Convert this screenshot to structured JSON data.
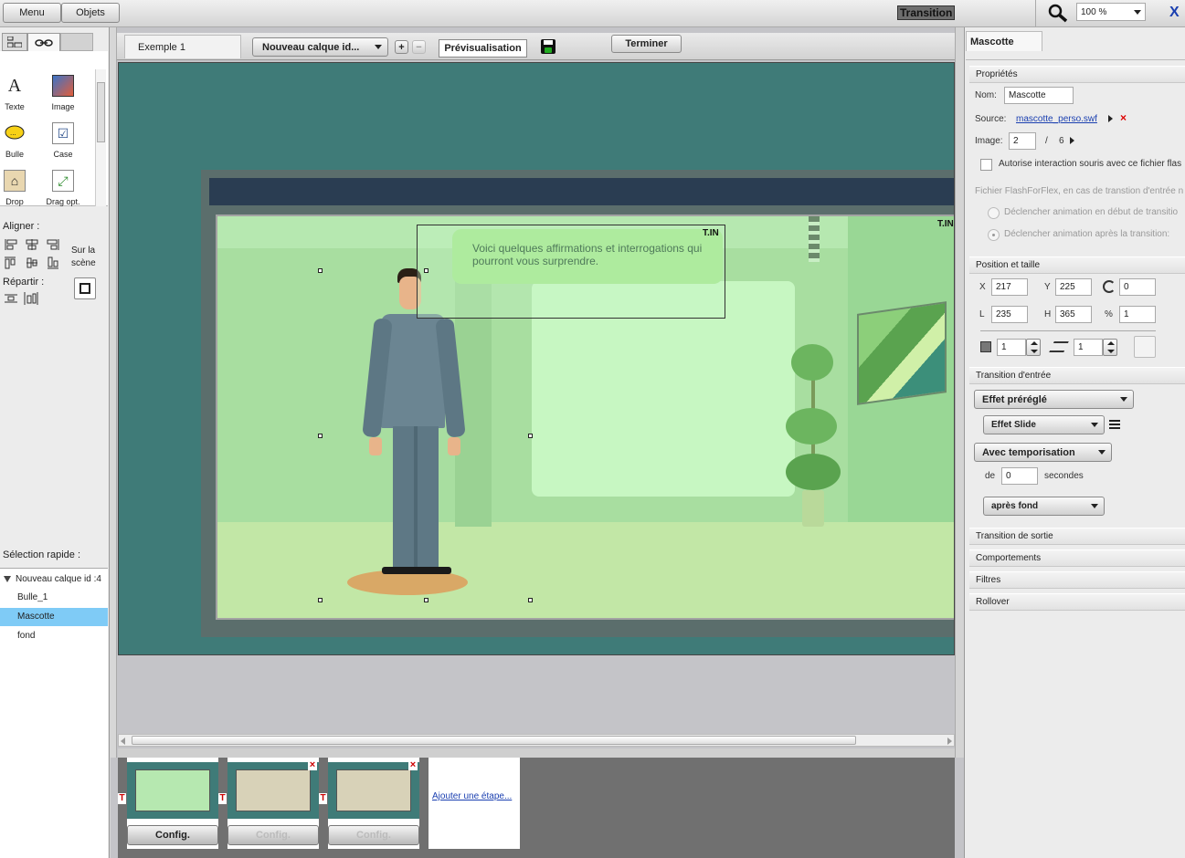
{
  "topbar": {
    "menu": "Menu",
    "objets": "Objets",
    "mode": "Transition",
    "zoom": "100 %",
    "close": "X"
  },
  "tools": [
    {
      "label": "Texte",
      "icon": "text-tool-icon",
      "glyph": "A"
    },
    {
      "label": "Image",
      "icon": "image-tool-icon",
      "glyph": "▣"
    },
    {
      "label": "Bulle",
      "icon": "speech-bubble-icon",
      "glyph": "💬"
    },
    {
      "label": "Case",
      "icon": "checkbox-tool-icon",
      "glyph": "☑"
    },
    {
      "label": "Drop",
      "icon": "drop-tool-icon",
      "glyph": "⌂"
    },
    {
      "label": "Drag opt.",
      "icon": "drag-option-icon",
      "glyph": "⤢"
    }
  ],
  "align": {
    "title": "Aligner :",
    "scene": "Sur la scène",
    "repartir": "Répartir :"
  },
  "quick": {
    "title": "Sélection rapide :",
    "root": "Nouveau calque id :4",
    "items": [
      "Bulle_1",
      "Mascotte",
      "fond"
    ]
  },
  "editor": {
    "tab": "Exemple 1",
    "layer": "Nouveau calque id...",
    "preview": "Prévisualisation",
    "finish": "Terminer",
    "plus": "+",
    "minus": "−"
  },
  "stage": {
    "bubble_text": "Voici quelques affirmations et interrogations qui pourront vous surprendre.",
    "tin1": "T.IN",
    "tin2": "T.IN"
  },
  "steps": {
    "config": "Config.",
    "add": "Ajouter une étape...",
    "t": "T",
    "x": "×"
  },
  "panel": {
    "title": "Mascotte",
    "props": "Propriétés",
    "nom_label": "Nom:",
    "nom": "Mascotte",
    "source_label": "Source:",
    "source": "mascotte_perso.swf",
    "image_label": "Image:",
    "image": "2",
    "slash": "/",
    "image_total": "6",
    "interaction": "Autorise interaction souris avec ce fichier flas",
    "flashforflex": "Fichier FlashForFlex, en cas de transtion d'entrée n",
    "radio1": "Déclencher animation en début de transitio",
    "radio2": "Déclencher animation après la transition:",
    "pos_title": "Position et taille",
    "x_label": "X",
    "x": "217",
    "y_label": "Y",
    "y": "225",
    "rot": "0",
    "l_label": "L",
    "l": "235",
    "h_label": "H",
    "h": "365",
    "pct_label": "%",
    "pct": "1",
    "depth1": "1",
    "depth2": "1",
    "trans_in": "Transition d'entrée",
    "preset": "Effet préréglé",
    "effect": "Effet Slide",
    "timing": "Avec temporisation",
    "de": "de",
    "seconds_value": "0",
    "seconds": "secondes",
    "after": "après fond",
    "trans_out": "Transition de sortie",
    "behaviors": "Comportements",
    "filters": "Filtres",
    "rollover": "Rollover"
  }
}
